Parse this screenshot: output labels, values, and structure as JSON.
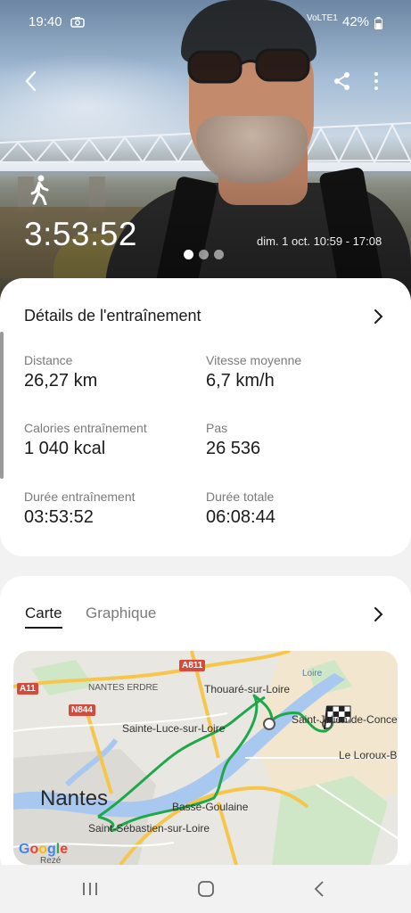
{
  "status_bar": {
    "time": "19:40",
    "signal_text": "VoLTE1",
    "battery": "42%"
  },
  "activity": {
    "duration": "3:53:52",
    "date_range": "dim. 1 oct. 10:59 - 17:08",
    "carousel_pages": 3,
    "carousel_active": 1
  },
  "details": {
    "title": "Détails de l'entraînement",
    "stats": [
      {
        "label": "Distance",
        "value": "26,27 km"
      },
      {
        "label": "Vitesse moyenne",
        "value": "6,7 km/h"
      },
      {
        "label": "Calories entraînement",
        "value": "1 040 kcal"
      },
      {
        "label": "Pas",
        "value": "26 536"
      },
      {
        "label": "Durée entraînement",
        "value": "03:53:52"
      },
      {
        "label": "Durée totale",
        "value": "06:08:44"
      }
    ]
  },
  "map_section": {
    "tabs": [
      {
        "label": "Carte",
        "active": true
      },
      {
        "label": "Graphique",
        "active": false
      }
    ],
    "map": {
      "places": {
        "nantes": "Nantes",
        "nantes_erdre": "NANTES ERDRE",
        "thouare": "Thouaré-sur-Loire",
        "sainte_luce": "Sainte-Luce-sur-Loire",
        "saint_julien": "Saint-Julien-de-Concelles",
        "le_loroux": "Le Loroux-B",
        "basse_goulaine": "Basse-Goulaine",
        "saint_sebastien": "Saint-Sébastien-sur-Loire",
        "reze": "Rezé",
        "loire": "Loire"
      },
      "roads": {
        "a11": "A11",
        "a811": "A811",
        "n844": "N844"
      },
      "attribution": [
        "G",
        "o",
        "o",
        "g",
        "l",
        "e"
      ],
      "colors": {
        "route": "#1ea84a",
        "water": "#a9c8ef",
        "land": "#e9e7e2",
        "urban": "#f3e6cf",
        "park": "#cfe7c6",
        "major_road": "#f6c64b"
      }
    }
  }
}
